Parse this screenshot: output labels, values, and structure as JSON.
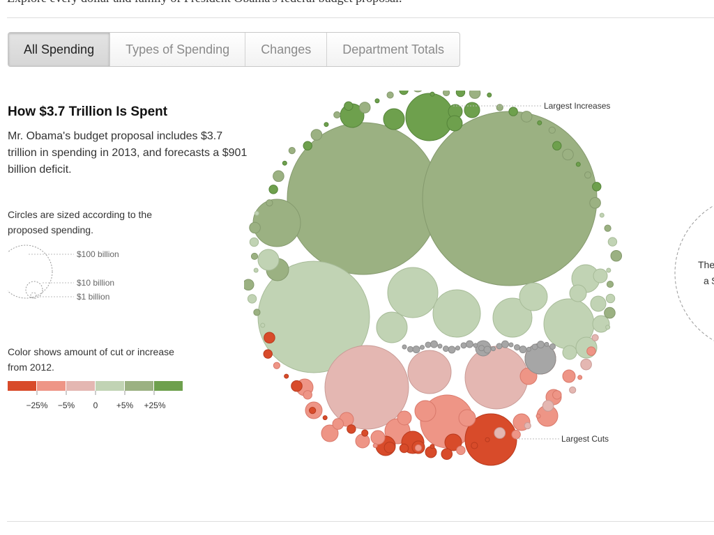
{
  "page": {
    "intro_text": "Explore every dollar and family of President Obama's federal budget proposal.",
    "outro_text": ""
  },
  "tabs": [
    {
      "label": "All Spending",
      "active": true
    },
    {
      "label": "Types of Spending",
      "active": false
    },
    {
      "label": "Changes",
      "active": false
    },
    {
      "label": "Department Totals",
      "active": false
    }
  ],
  "panel": {
    "title": "How $3.7 Trillion Is Spent",
    "description": "Mr. Obama's budget proposal includes $3.7 trillion in spending in 2013, and forecasts a $901 billion deficit.",
    "size_note": "Circles are sized according to the proposed spending.",
    "size_labels": [
      "$100 billion",
      "$10 billion",
      "$1 billion"
    ],
    "color_note": "Color shows amount of cut or increase from 2012.",
    "color_scale": [
      "#d84b2a",
      "#ee9586",
      "#e4b7b2",
      "#c1d3b4",
      "#9bb182",
      "#6ea04d"
    ],
    "color_scale_labels": [
      "−25%",
      "−5%",
      "0",
      "+5%",
      "+25%"
    ]
  },
  "side_panel": {
    "line1": "The",
    "line2": "a $"
  },
  "chart_data": {
    "type": "bubble",
    "title": "How $3.7 Trillion Is Spent",
    "annotations": [
      "Largest Increases",
      "Largest Cuts"
    ],
    "color_meaning": "change from 2012",
    "size_meaning": "proposed spending"
  }
}
